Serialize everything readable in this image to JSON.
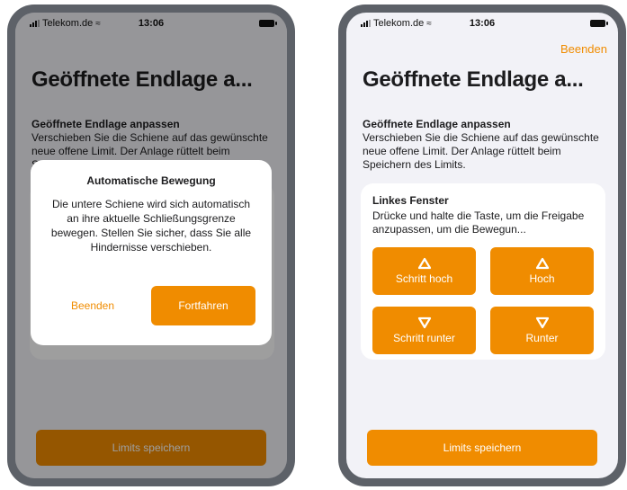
{
  "colors": {
    "accent": "#f08c00",
    "background": "#f2f2f7",
    "bezel": "#5d6168"
  },
  "status_bar": {
    "carrier": "Telekom.de",
    "time": "13:06"
  },
  "left_screen": {
    "title": "Geöffnete Endlage a...",
    "section_heading": "Geöffnete Endlage anpassen",
    "section_text": "Verschieben Sie die Schiene auf das gewünschte neue offene Limit. Der Anlage rüttelt beim Speichern des Limits.",
    "save_label": "Limits speichern",
    "dialog": {
      "title": "Automatische Bewegung",
      "message": "Die untere Schiene wird sich automatisch an ihre aktuelle Schließungsgrenze bewegen. Stellen Sie sicher, dass Sie alle Hindernisse verschieben.",
      "cancel_label": "Beenden",
      "continue_label": "Fortfahren"
    }
  },
  "right_screen": {
    "nav_action": "Beenden",
    "title": "Geöffnete Endlage a...",
    "section_heading": "Geöffnete Endlage anpassen",
    "section_text": "Verschieben Sie die Schiene auf das gewünschte neue offene Limit. Der Anlage rüttelt beim Speichern des Limits.",
    "card": {
      "title": "Linkes Fenster",
      "text": "Drücke und halte die Taste, um die Freigabe anzupassen, um die Bewegun..."
    },
    "buttons": [
      {
        "label": "Schritt hoch",
        "icon": "triangle-up-icon"
      },
      {
        "label": "Hoch",
        "icon": "triangle-up-icon"
      },
      {
        "label": "Schritt runter",
        "icon": "triangle-down-icon"
      },
      {
        "label": "Runter",
        "icon": "triangle-down-icon"
      }
    ],
    "save_label": "Limits speichern"
  }
}
